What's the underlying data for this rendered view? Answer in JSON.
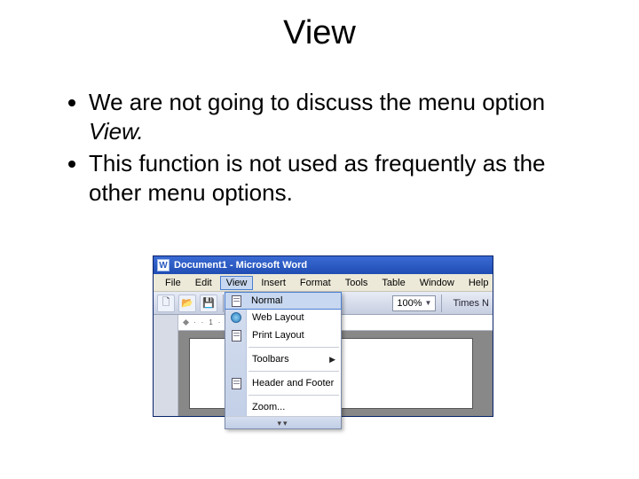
{
  "slide": {
    "title": "View",
    "bullet1_a": "We are not going to discuss the menu option ",
    "bullet1_b": "View.",
    "bullet2": "This function is not used as frequently as the other menu options."
  },
  "word": {
    "title": "Document1 - Microsoft Word",
    "menu": {
      "file": "File",
      "edit": "Edit",
      "view": "View",
      "insert": "Insert",
      "format": "Format",
      "tools": "Tools",
      "table": "Table",
      "window": "Window",
      "help": "Help"
    },
    "zoom": "100%",
    "font_label": "Times N",
    "dropdown": {
      "normal": "Normal",
      "web": "Web Layout",
      "print": "Print Layout",
      "toolbars": "Toolbars",
      "header": "Header and Footer",
      "zoom": "Zoom..."
    }
  }
}
